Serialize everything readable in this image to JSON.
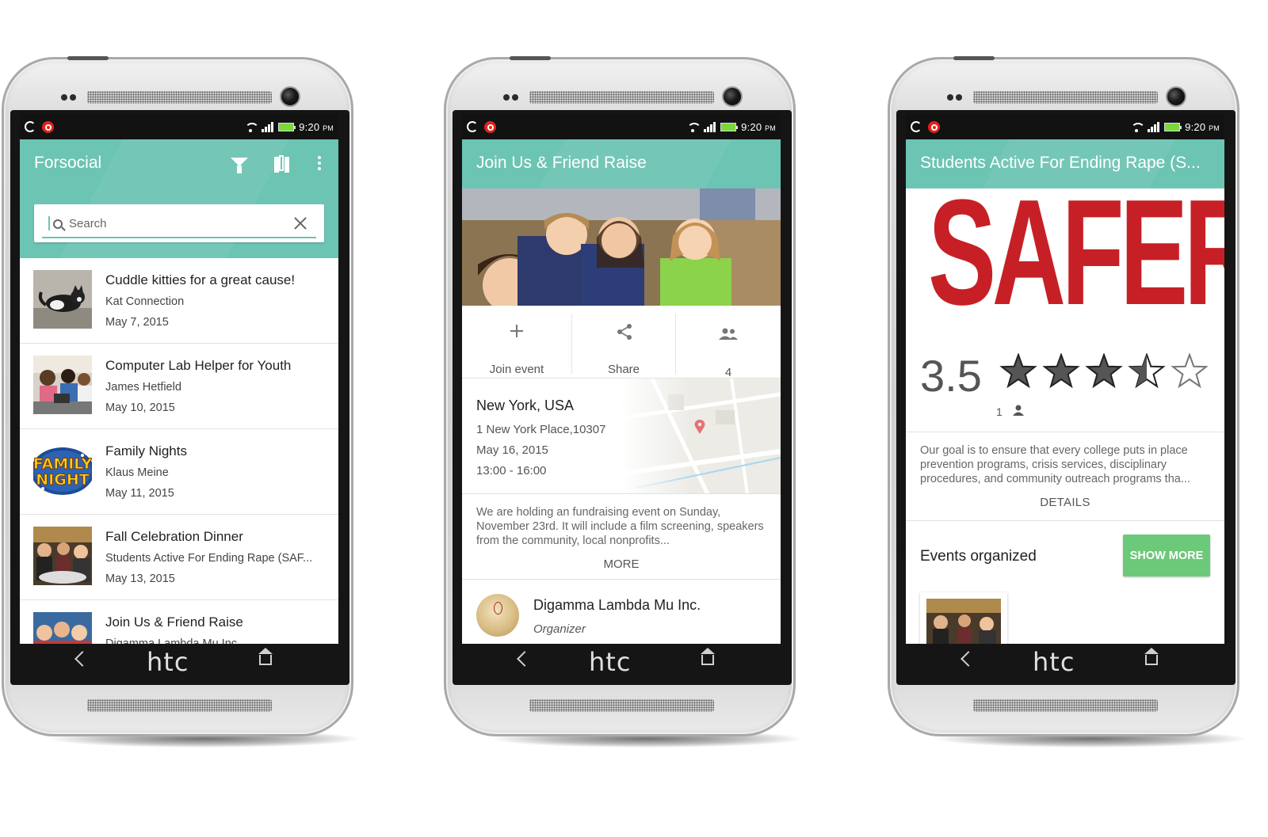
{
  "status_bar": {
    "time": "9:20",
    "ampm": "PM"
  },
  "device": {
    "brand": "htc"
  },
  "colors": {
    "primary": "#6cc4b3",
    "accent_green": "#6cc979",
    "logo_red": "#c62026"
  },
  "screen1": {
    "title": "Forsocial",
    "search_placeholder": "Search",
    "items": [
      {
        "title": "Cuddle kitties for a great cause!",
        "org": "Kat Connection",
        "date": "May 7, 2015"
      },
      {
        "title": "Computer Lab Helper for Youth",
        "org": "James Hetfield",
        "date": "May 10, 2015"
      },
      {
        "title": "Family Nights",
        "org": "Klaus Meine",
        "date": "May 11, 2015"
      },
      {
        "title": "Fall Celebration Dinner",
        "org": "Students Active For Ending Rape (SAF...",
        "date": "May 13, 2015"
      },
      {
        "title": "Join Us & Friend Raise",
        "org": "Digamma Lambda Mu Inc.",
        "date": ""
      }
    ],
    "thumb_text": {
      "family_nights": [
        "FAMILY",
        "NIGHT"
      ]
    }
  },
  "screen2": {
    "title": "Join Us & Friend Raise",
    "actions": {
      "join": "Join event",
      "share": "Share",
      "attendees": "4"
    },
    "location": {
      "city": "New York, USA",
      "address": "1 New York Place,10307",
      "date": "May 16, 2015",
      "time": "13:00 - 16:00"
    },
    "description": "We are holding an fundraising event on Sunday, November 23rd. It will include a film screening, speakers from the community, local nonprofits...",
    "more_label": "MORE",
    "organizer": {
      "name": "Digamma Lambda Mu Inc.",
      "role": "Organizer"
    }
  },
  "screen3": {
    "title": "Students Active For Ending Rape (S...",
    "logo_text": "SAFER",
    "rating": {
      "value": "3.5",
      "stars": 3.5,
      "max_stars": 5,
      "count": "1"
    },
    "about": "Our goal is to ensure that every college puts in place prevention programs, crisis services, disciplinary procedures, and community outreach programs tha...",
    "details_label": "DETAILS",
    "events_title": "Events organized",
    "show_more_label": "SHOW MORE"
  }
}
